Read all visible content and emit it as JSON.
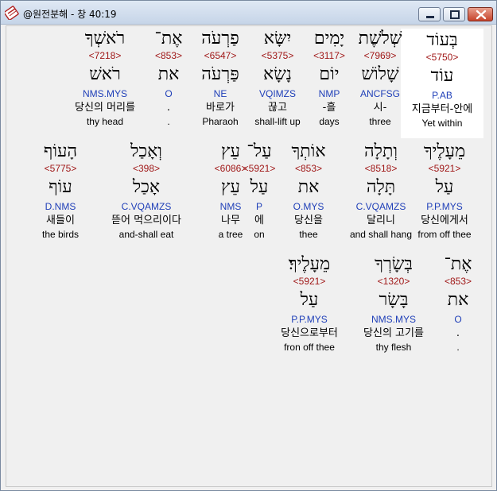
{
  "window": {
    "title": "@원전분해 - 창 40:19",
    "icon": "bible-app-icon"
  },
  "rows": [
    [
      {
        "heb": "בְּעוֹד",
        "strong": "<5750>",
        "lemma": "עוֹד",
        "morph": "P.AB",
        "ko": "지금부터-안에",
        "en": "Yet within",
        "highlighted": true
      },
      {
        "heb": "שְׁלֹשֶׁת",
        "strong": "<7969>",
        "lemma": "שָׁלוֹשׁ",
        "morph": "ANCFSG",
        "ko": "시-",
        "en": "three"
      },
      {
        "heb": "יָמִים",
        "strong": "<3117>",
        "lemma": "יוֹם",
        "morph": "NMP",
        "ko": "-흘",
        "en": "days"
      },
      {
        "heb": "יִשָּׂא",
        "strong": "<5375>",
        "lemma": "נָשָׂא",
        "morph": "VQIMZS",
        "ko": "끊고",
        "en": "shall-lift up"
      },
      {
        "heb": "פַרְעֹה",
        "strong": "<6547>",
        "lemma": "פַּרְעֹה",
        "morph": "NE",
        "ko": "바로가",
        "en": "Pharaoh"
      },
      {
        "heb": "אֶת־",
        "strong": "<853>",
        "lemma": "את",
        "morph": "O",
        "ko": ".",
        "en": "."
      },
      {
        "heb": "רֹאשְׁךָ",
        "strong": "<7218>",
        "lemma": "רֹאשׁ",
        "morph": "NMS.MYS",
        "ko": "당신의 머리를",
        "en": "thy head"
      }
    ],
    [
      {
        "heb": "מֵעָלֶיךָ",
        "strong": "<5921>",
        "lemma": "עַל",
        "morph": "P.P.MYS",
        "ko": "당신에게서",
        "en": "from off thee"
      },
      {
        "heb": "וְתָלָה",
        "strong": "<8518>",
        "lemma": "תָּלָה",
        "morph": "C.VQAMZS",
        "ko": "달리니",
        "en": "and shall hang"
      },
      {
        "heb": "אוֹתְךָ",
        "strong": "<853>",
        "lemma": "את",
        "morph": "O.MYS",
        "ko": "당신을",
        "en": "thee"
      },
      {
        "heb": "עַל־",
        "strong": "<5921>",
        "lemma": "עַל",
        "morph": "P",
        "ko": "에",
        "en": "on"
      },
      {
        "heb": "עֵץ",
        "strong": "<6086>",
        "lemma": "עֵץ",
        "morph": "NMS",
        "ko": "나무",
        "en": "a tree"
      },
      {
        "heb": "וְאָכַל",
        "strong": "<398>",
        "lemma": "אָכַל",
        "morph": "C.VQAMZS",
        "ko": "뜯어 먹으리이다",
        "en": "and-shall eat"
      },
      {
        "heb": "הָעוֹף",
        "strong": "<5775>",
        "lemma": "עוֹף",
        "morph": "D.NMS",
        "ko": "새들이",
        "en": "the birds"
      }
    ],
    [
      {
        "heb": "אֶת־",
        "strong": "<853>",
        "lemma": "את",
        "morph": "O",
        "ko": ".",
        "en": "."
      },
      {
        "heb": "בְּשָׂרְךָ",
        "strong": "<1320>",
        "lemma": "בָּשָׂר",
        "morph": "NMS.MYS",
        "ko": "당신의 고기를",
        "en": "thy flesh"
      },
      {
        "heb": "מֵעָלֶיךָ׃",
        "strong": "<5921>",
        "lemma": "עַל",
        "morph": "P.P.MYS",
        "ko": "당신으로부터",
        "en": "fron off thee"
      }
    ]
  ],
  "colors": {
    "strong": "#a01818",
    "morph": "#1f3fb8",
    "highlight": "#ffffff"
  }
}
